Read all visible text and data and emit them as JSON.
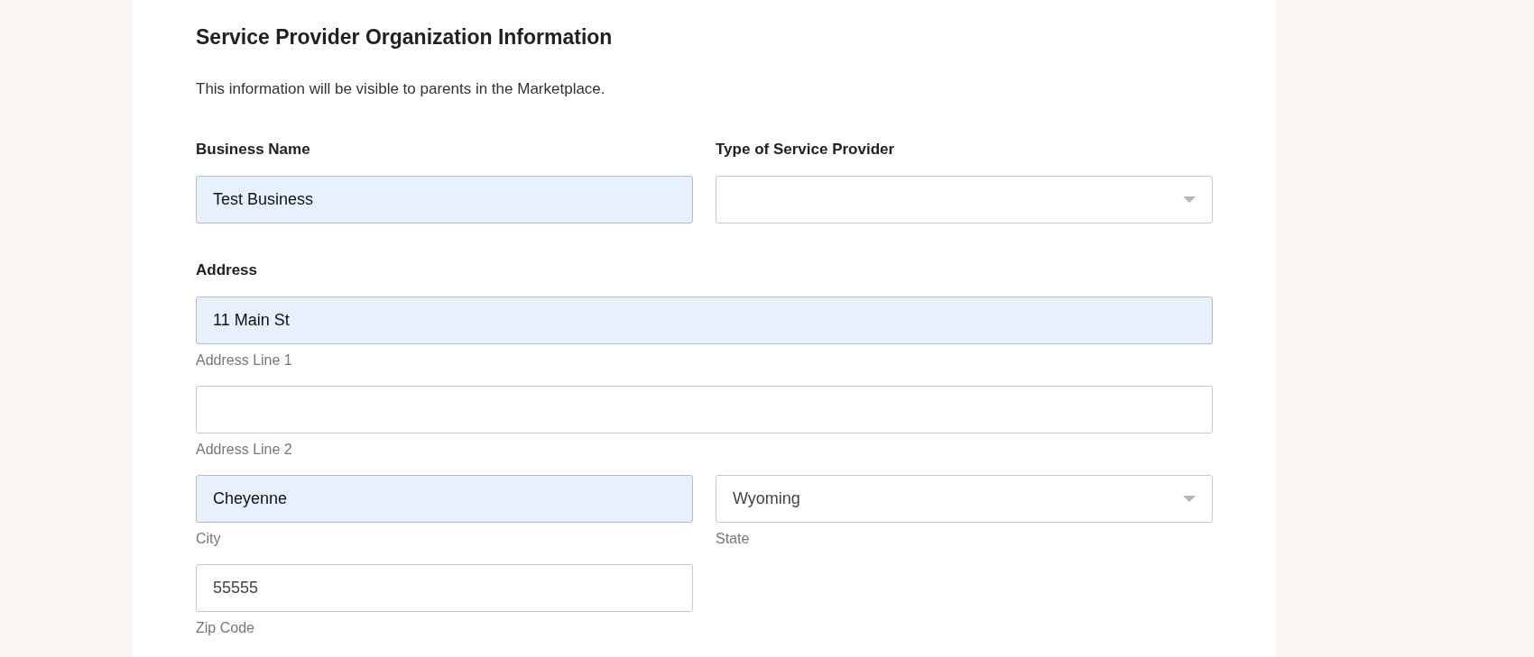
{
  "title": "Service Provider Organization Information",
  "description": "This information will be visible to parents in the Marketplace.",
  "top_fields": [
    {
      "label": "Business Name",
      "kind": "text",
      "value": "Test Business",
      "autofilled": true
    },
    {
      "label": "Type of Service Provider",
      "kind": "select",
      "autofilled": false
    }
  ],
  "address": {
    "label": "Address",
    "rows": [
      [
        {
          "kind": "text",
          "value": "11 Main St",
          "hint": "Address Line 1",
          "autofilled": true,
          "wide": true
        }
      ],
      [
        {
          "kind": "text",
          "hint": "Address Line 2",
          "autofilled": false,
          "wide": true
        }
      ],
      [
        {
          "kind": "text",
          "value": "Cheyenne",
          "hint": "City",
          "autofilled": true,
          "wide": false
        },
        {
          "kind": "select",
          "value": "Wyoming",
          "hint": "State",
          "autofilled": false,
          "wide": false
        }
      ],
      [
        {
          "kind": "text",
          "value": "55555",
          "hint": "Zip Code",
          "autofilled": false,
          "wide": false
        }
      ]
    ]
  }
}
